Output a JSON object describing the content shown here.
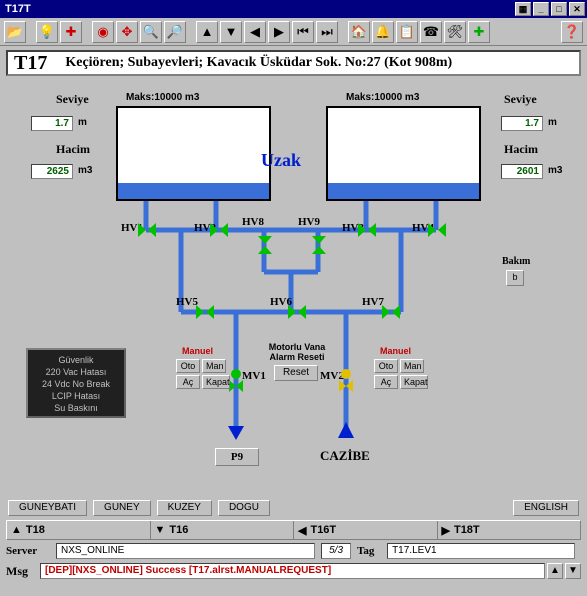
{
  "window": {
    "title": "T17T"
  },
  "header": {
    "code": "T17",
    "desc": "Keçiören; Subayevleri; Kavacık Üsküdar Sok. No:27 (Kot 908m)"
  },
  "tank1": {
    "maks_label": "Maks:10000  m3",
    "seviye_label": "Seviye",
    "seviye_val": "1.7",
    "seviye_unit": "m",
    "hacim_label": "Hacim",
    "hacim_val": "2625",
    "hacim_unit": "m3"
  },
  "tank2": {
    "maks_label": "Maks:10000  m3",
    "seviye_label": "Seviye",
    "seviye_val": "1.7",
    "seviye_unit": "m",
    "hacim_label": "Hacim",
    "hacim_val": "2601",
    "hacim_unit": "m3"
  },
  "uzak": "Uzak",
  "valves": {
    "hv1": "HV1",
    "hv2": "HV2",
    "hv3": "HV3",
    "hv4": "HV4",
    "hv5": "HV5",
    "hv6": "HV6",
    "hv7": "HV7",
    "hv8": "HV8",
    "hv9": "HV9",
    "mv1": "MV1",
    "mv2": "MV2"
  },
  "ctrl": {
    "manual": "Manuel",
    "oto": "Oto",
    "man": "Man",
    "ac": "Aç",
    "kapat": "Kapat",
    "reset_title1": "Motorlu Vana",
    "reset_title2": "Alarm Reseti",
    "reset": "Reset"
  },
  "bakim": {
    "label": "Bakım",
    "btn": "b"
  },
  "alarms": {
    "l1": "Güvenlik",
    "l2": "220 Vac Hatası",
    "l3": "24 Vdc No Break",
    "l4": "LCIP Hatası",
    "l5": "Su Baskını"
  },
  "outlets": {
    "p9": "P9",
    "cazibe": "CAZİBE"
  },
  "regions": {
    "gb": "GUNEYBATI",
    "g": "GUNEY",
    "k": "KUZEY",
    "d": "DOGU",
    "en": "ENGLISH"
  },
  "nav": {
    "a": "T18",
    "b": "T16",
    "c": "T16T",
    "d": "T18T"
  },
  "server": {
    "label": "Server",
    "val": "NXS_ONLINE",
    "page": "5/3",
    "tag_label": "Tag",
    "tag_val": "T17.LEV1"
  },
  "msg": {
    "label": "Msg",
    "text": "[DEP][NXS_ONLINE] Success [T17.alrst.MANUALREQUEST]"
  }
}
